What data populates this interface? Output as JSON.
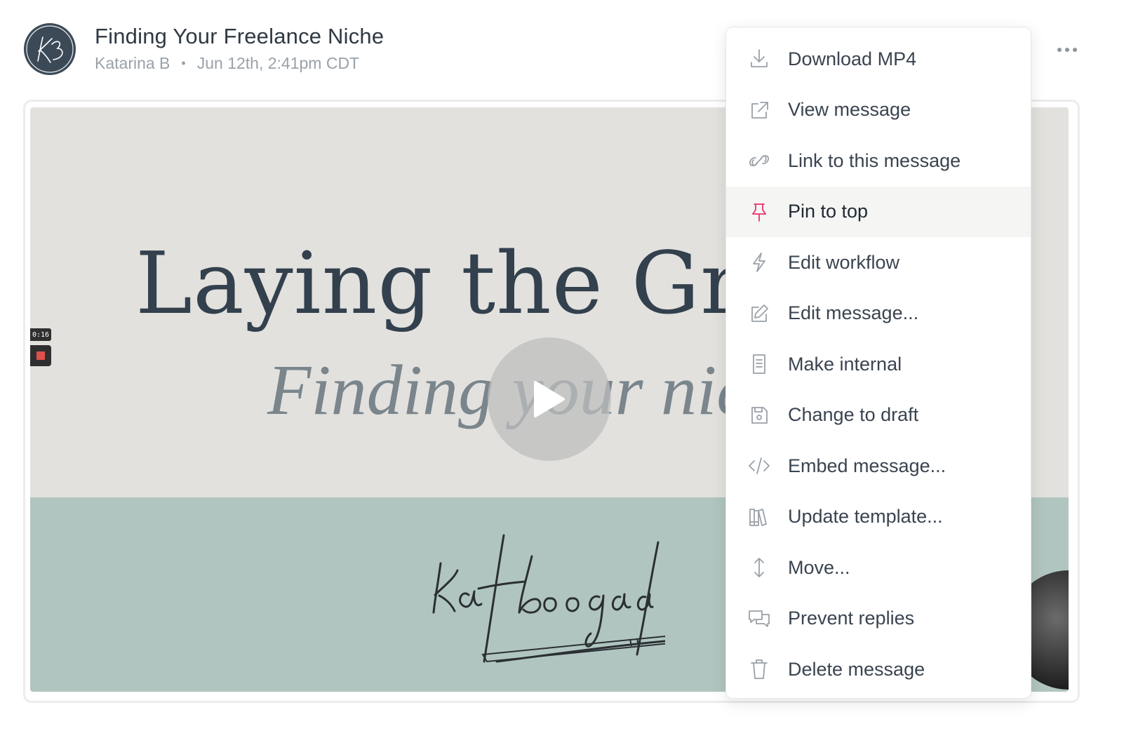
{
  "header": {
    "title": "Finding Your Freelance Niche",
    "author": "Katarina B",
    "separator": "•",
    "timestamp": "Jun 12th, 2:41pm CDT",
    "avatar_icon": "kb-monogram-icon",
    "more_icon": "more-horizontal-icon"
  },
  "video": {
    "heading": "Laying the Groun",
    "subheading": "Finding your nic",
    "signature": "kat boogaard",
    "recording_timer": "0:16",
    "play_icon": "play-icon",
    "colors": {
      "top": "#e2e1de",
      "bottom": "#b1c5c0"
    }
  },
  "menu": {
    "items": [
      {
        "label": "Download MP4",
        "icon": "download-icon"
      },
      {
        "label": "View message",
        "icon": "external-link-icon"
      },
      {
        "label": "Link to this message",
        "icon": "link-icon"
      },
      {
        "label": "Pin to top",
        "icon": "pin-icon",
        "highlighted": true,
        "icon_color": "#e8336d"
      },
      {
        "label": "Edit workflow",
        "icon": "lightning-icon"
      },
      {
        "label": "Edit message...",
        "icon": "edit-icon"
      },
      {
        "label": "Make internal",
        "icon": "document-icon"
      },
      {
        "label": "Change to draft",
        "icon": "save-icon"
      },
      {
        "label": "Embed message...",
        "icon": "code-icon"
      },
      {
        "label": "Update template...",
        "icon": "library-icon"
      },
      {
        "label": "Move...",
        "icon": "move-vertical-icon"
      },
      {
        "label": "Prevent replies",
        "icon": "chat-bubbles-icon"
      },
      {
        "label": "Delete message",
        "icon": "trash-icon"
      }
    ]
  }
}
